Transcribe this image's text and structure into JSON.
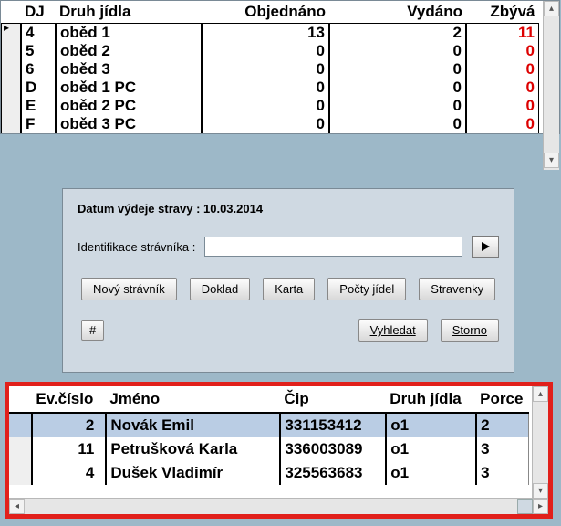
{
  "top": {
    "headers": {
      "dj": "DJ",
      "druh": "Druh jídla",
      "obj": "Objednáno",
      "vyd": "Vydáno",
      "zby": "Zbývá"
    },
    "rows": [
      {
        "dj": "4",
        "name": "oběd 1",
        "obj": "13",
        "vyd": "2",
        "zby": "11"
      },
      {
        "dj": "5",
        "name": "oběd 2",
        "obj": "0",
        "vyd": "0",
        "zby": "0"
      },
      {
        "dj": "6",
        "name": "oběd 3",
        "obj": "0",
        "vyd": "0",
        "zby": "0"
      },
      {
        "dj": "D",
        "name": "oběd 1 PC",
        "obj": "0",
        "vyd": "0",
        "zby": "0"
      },
      {
        "dj": "E",
        "name": "oběd 2 PC",
        "obj": "0",
        "vyd": "0",
        "zby": "0"
      },
      {
        "dj": "F",
        "name": "oběd 3 PC",
        "obj": "0",
        "vyd": "0",
        "zby": "0"
      }
    ]
  },
  "panel": {
    "date_line": "Datum výdeje stravy : 10.03.2014",
    "ident_label": "Identifikace strávníka :",
    "ident_value": "",
    "btn_novy": "Nový strávník",
    "btn_doklad": "Doklad",
    "btn_karta": "Karta",
    "btn_pocty": "Počty jídel",
    "btn_strav": "Stravenky",
    "btn_hash": "#",
    "btn_vyhledat": "Vyhledat",
    "btn_storno": "Storno"
  },
  "bottom": {
    "headers": {
      "ev": "Ev.číslo",
      "jm": "Jméno",
      "cip": "Čip",
      "dj": "Druh jídla",
      "por": "Porce"
    },
    "rows": [
      {
        "ev": "2",
        "jm": "Novák Emil",
        "cip": "331153412",
        "dj": "o1",
        "por": "2",
        "sel": true
      },
      {
        "ev": "11",
        "jm": "Petrušková Karla",
        "cip": "336003089",
        "dj": "o1",
        "por": "3",
        "sel": false
      },
      {
        "ev": "4",
        "jm": "Dušek Vladimír",
        "cip": "325563683",
        "dj": "o1",
        "por": "3",
        "sel": false
      }
    ]
  }
}
